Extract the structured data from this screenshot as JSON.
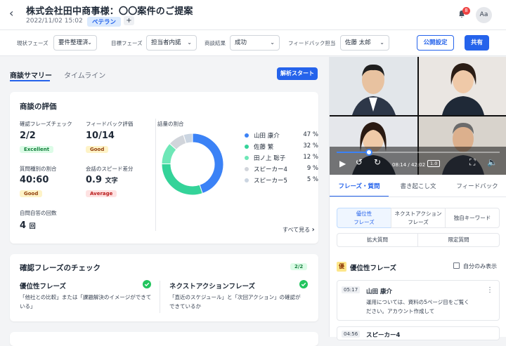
{
  "header": {
    "title": "株式会社田中商事様：〇〇案件のご提案",
    "date": "2022/11/02 15:02",
    "tag": "ベテラン",
    "add": "+",
    "notification_count": "8",
    "avatar_initials": "Aa"
  },
  "filters": [
    {
      "label": "現状フェーズ",
      "value": "要件整理済"
    },
    {
      "label": "目標フェーズ",
      "value": "担当者内諾"
    },
    {
      "label": "商談結果",
      "value": "成功"
    },
    {
      "label": "フィードバック担当",
      "value": "佐藤 太郎"
    }
  ],
  "actions": {
    "public": "公開設定",
    "share": "共有"
  },
  "left_tabs": {
    "summary": "商談サマリー",
    "timeline": "タイムライン",
    "start": "解析スタート"
  },
  "eval": {
    "title": "商談の評価",
    "metrics": [
      {
        "label": "確認フレーズチェック",
        "value": "2/2",
        "unit": "",
        "status": "Excellent"
      },
      {
        "label": "フィードバック評価",
        "value": "10/14",
        "unit": "",
        "status": "Good"
      },
      {
        "label": "質問種別の割合",
        "value": "40:60",
        "unit": "",
        "status": "Good"
      },
      {
        "label": "会話のスピード差分",
        "value": "0.9",
        "unit": "文字",
        "status": "Average"
      },
      {
        "label": "自問自答の回数",
        "value": "4",
        "unit": "回",
        "status": ""
      }
    ],
    "talk_title": "話量の割合",
    "see_all": "すべて見る",
    "chevron": "›"
  },
  "chart_data": {
    "type": "pie",
    "title": "話量の割合",
    "categories": [
      "山田 康介",
      "佐藤 繁",
      "田ノ上 聡子",
      "スピーカー4",
      "スピーカー5"
    ],
    "values": [
      47,
      32,
      12,
      9,
      5
    ],
    "percent_labels": [
      "47 %",
      "32 %",
      "12 %",
      "9 %",
      "5 %"
    ],
    "colors": [
      "#3b82f6",
      "#34d399",
      "#6ee7b7",
      "#d1d5db",
      "#cbd5e1"
    ],
    "donut": true,
    "legend": "right"
  },
  "confirm": {
    "title": "確認フレーズのチェック",
    "badge": "2/2",
    "items": [
      {
        "title": "優位性フレーズ",
        "desc": "「他社との比較」または「課題解決のイメージができている」"
      },
      {
        "title": "ネクストアクションフレーズ",
        "desc": "「直近のスケジュール」と「次回アクション」の確認ができているか"
      }
    ]
  },
  "player": {
    "time": "08:14 / 42:02",
    "speed": "1.0",
    "progress": 0.2
  },
  "right_tabs": [
    "フレーズ・質問",
    "書き起こし文",
    "フィードバック"
  ],
  "segments": [
    "優位性\nフレーズ",
    "ネクストアクション\nフレーズ",
    "独自キーワード",
    "拡大質問",
    "限定質問"
  ],
  "phrase_panel": {
    "badge": "優",
    "title": "優位性フレーズ",
    "own_only": "自分のみ表示",
    "entries": [
      {
        "time": "05:17",
        "speaker": "山田 康介",
        "text": "運用については、資料の5ページ目をご覧ください。アカウント作成して"
      },
      {
        "time": "04:56",
        "speaker": "スピーカー4",
        "text": ""
      }
    ],
    "menu": "⋮"
  },
  "colors": {
    "accent": "#2563eb"
  }
}
